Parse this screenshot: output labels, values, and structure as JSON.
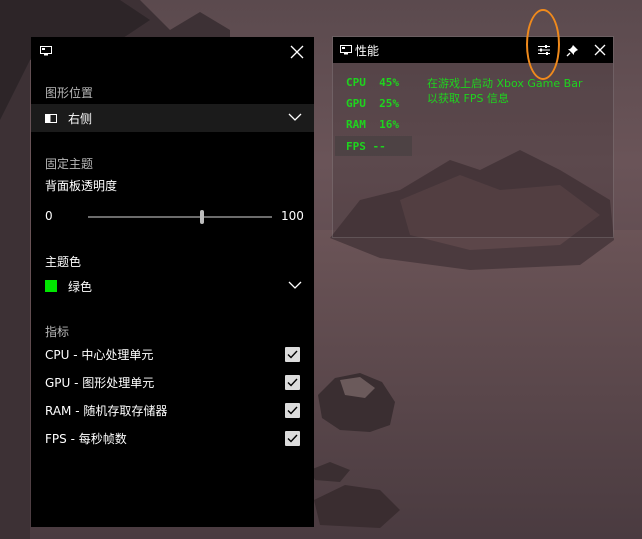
{
  "settings_panel": {
    "sections": {
      "graph_position": "图形位置",
      "pinned_theme": "固定主题",
      "theme_color": "主题色",
      "indicators": "指标"
    },
    "position_dropdown": {
      "value": "右侧"
    },
    "opacity": {
      "label": "背面板透明度",
      "min_label": "0",
      "max_label": "100",
      "value_percent": 62
    },
    "color_dropdown": {
      "value": "绿色",
      "swatch": "#00e600"
    },
    "metrics": [
      {
        "label": "CPU - 中心处理单元",
        "checked": true
      },
      {
        "label": "GPU - 图形处理单元",
        "checked": true
      },
      {
        "label": "RAM - 随机存取存储器",
        "checked": true
      },
      {
        "label": "FPS - 每秒帧数",
        "checked": true
      }
    ]
  },
  "perf_widget": {
    "title": "性能",
    "readouts": {
      "cpu": "CPU  45%",
      "gpu": "GPU  25%",
      "ram": "RAM  16%",
      "fps": "FPS --"
    },
    "hint_line1": "在游戏上启动 Xbox Game Bar",
    "hint_line2": "以获取 FPS 信息",
    "accent": "#1ed41e"
  },
  "icons": {
    "widget": "game-bar-widget-icon",
    "settings": "sliders-icon",
    "pin": "pin-icon",
    "close": "close-icon",
    "chevron": "chevron-down-icon",
    "check": "checkmark-icon"
  },
  "annotation_color": "#f08a1c"
}
